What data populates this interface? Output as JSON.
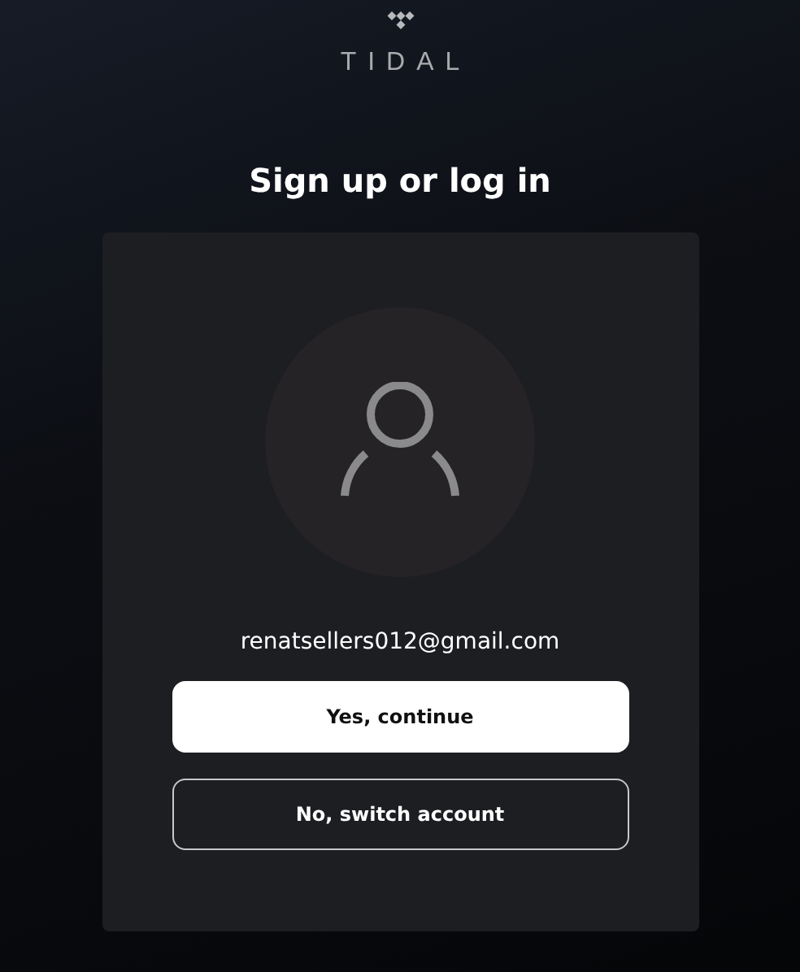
{
  "brand": {
    "name": "TIDAL"
  },
  "heading": "Sign up or log in",
  "account": {
    "email": "renatsellers012@gmail.com"
  },
  "buttons": [
    {
      "label": "Yes, continue",
      "kind": "primary"
    },
    {
      "label": "No, switch account",
      "kind": "secondary"
    }
  ]
}
